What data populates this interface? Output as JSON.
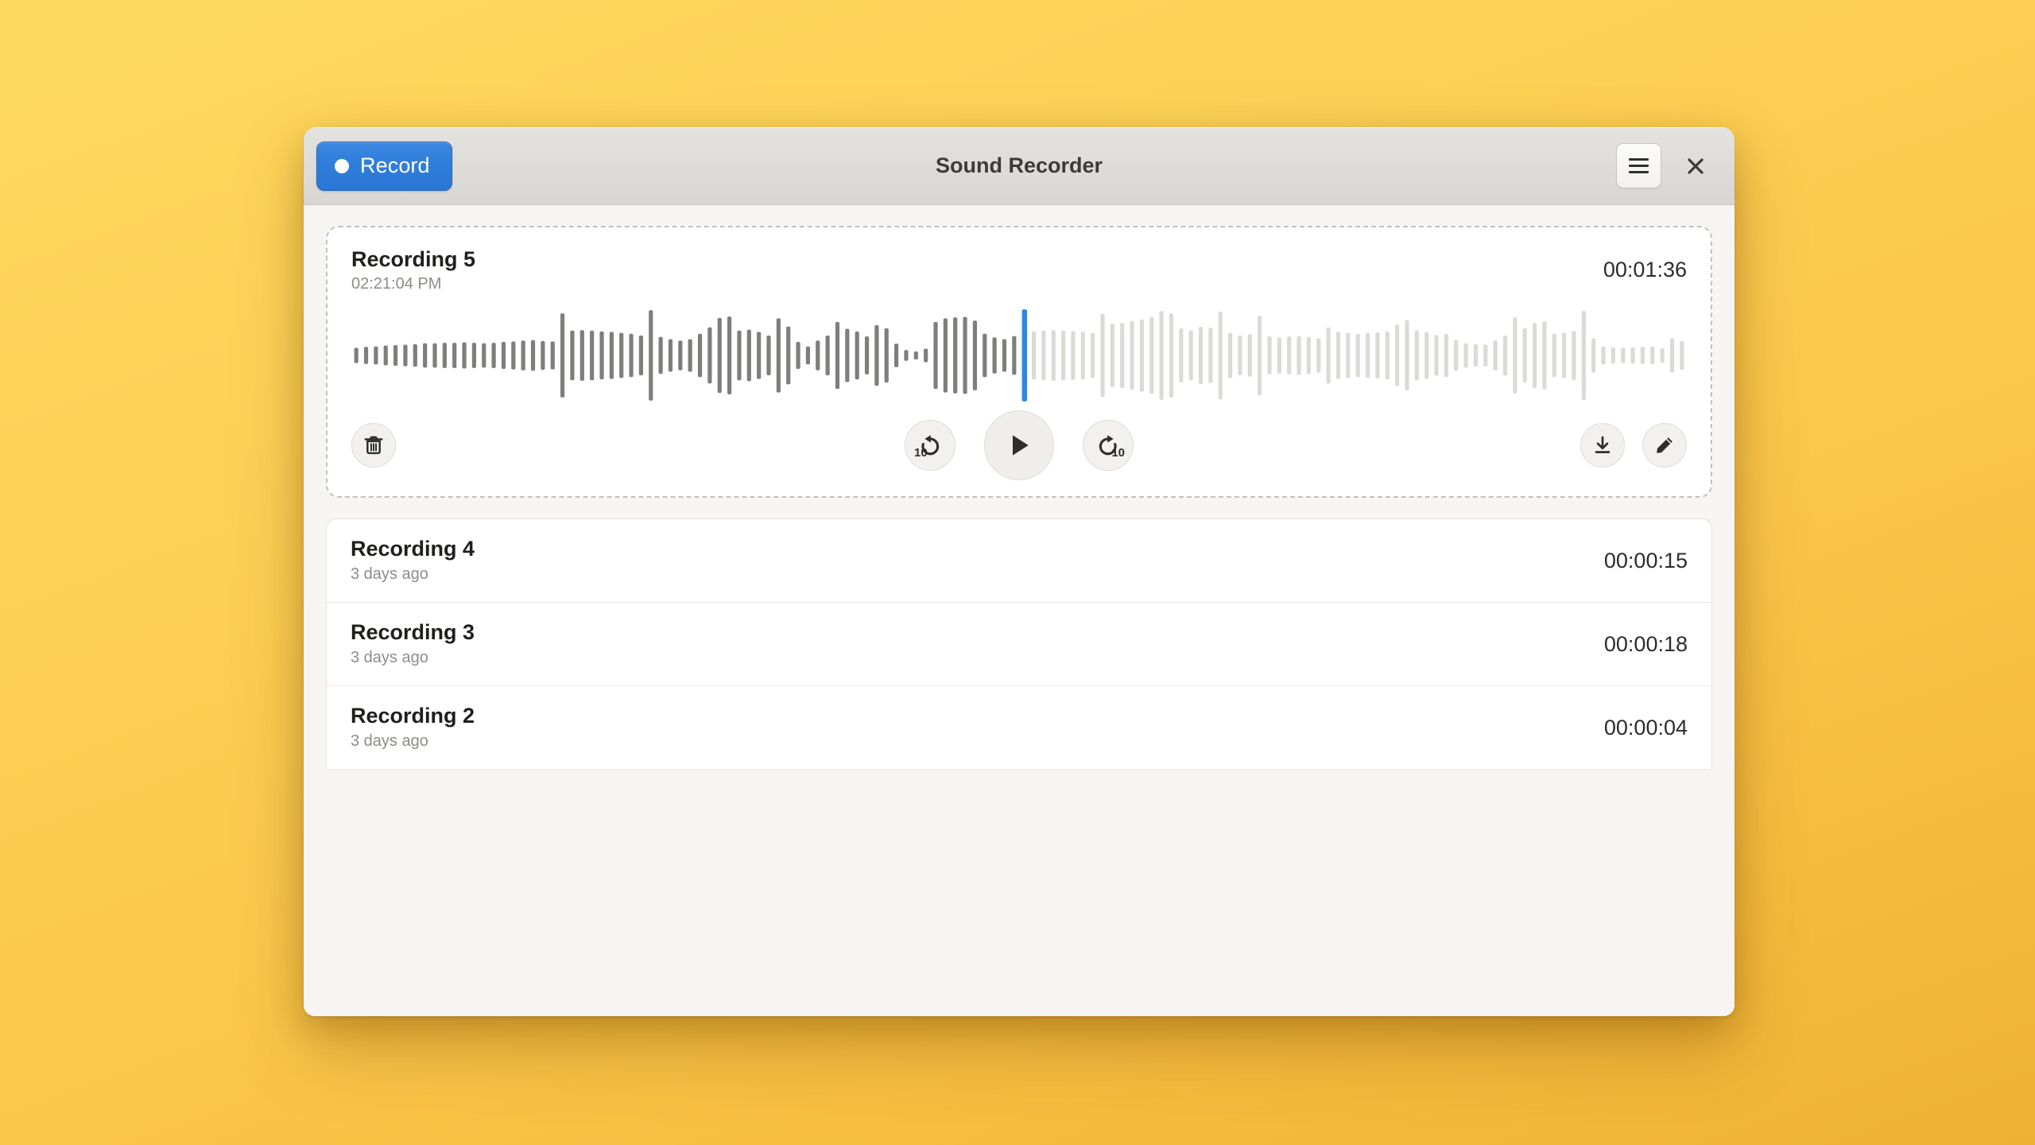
{
  "window": {
    "title": "Sound Recorder",
    "record_label": "Record",
    "menu_icon": "hamburger-menu-icon",
    "close_icon": "close-icon"
  },
  "player": {
    "name": "Recording 5",
    "timestamp": "02:21:04 PM",
    "duration": "00:01:36",
    "progress_percent": 50,
    "controls": {
      "delete_icon": "trash-icon",
      "seek_backward_label": "10",
      "seek_backward_icon": "seek-backward-10-icon",
      "play_icon": "play-icon",
      "seek_forward_label": "10",
      "seek_forward_icon": "seek-forward-10-icon",
      "export_icon": "download-icon",
      "rename_icon": "pencil-icon"
    },
    "waveform": {
      "played_color": "#7e7e7c",
      "unplayed_color": "#dcdad7",
      "playhead_color": "#3584e4",
      "amplitudes": [
        0.17,
        0.19,
        0.2,
        0.22,
        0.23,
        0.24,
        0.25,
        0.27,
        0.27,
        0.28,
        0.28,
        0.29,
        0.28,
        0.27,
        0.28,
        0.3,
        0.31,
        0.33,
        0.34,
        0.32,
        0.31,
        0.93,
        0.55,
        0.56,
        0.55,
        0.53,
        0.52,
        0.5,
        0.48,
        0.44,
        1.0,
        0.41,
        0.36,
        0.33,
        0.36,
        0.48,
        0.62,
        0.83,
        0.86,
        0.55,
        0.57,
        0.52,
        0.44,
        0.82,
        0.64,
        0.3,
        0.2,
        0.33,
        0.44,
        0.74,
        0.59,
        0.53,
        0.42,
        0.67,
        0.6,
        0.26,
        0.12,
        0.09,
        0.15,
        0.74,
        0.82,
        0.84,
        0.85,
        0.77,
        0.48,
        0.4,
        0.36,
        0.43,
        0.9,
        0.53,
        0.55,
        0.56,
        0.55,
        0.54,
        0.53,
        0.5,
        0.92,
        0.7,
        0.72,
        0.76,
        0.8,
        0.85,
        0.98,
        0.93,
        0.6,
        0.55,
        0.63,
        0.61,
        0.97,
        0.5,
        0.44,
        0.47,
        0.88,
        0.42,
        0.4,
        0.42,
        0.43,
        0.41,
        0.38,
        0.62,
        0.52,
        0.5,
        0.48,
        0.5,
        0.51,
        0.53,
        0.68,
        0.78,
        0.55,
        0.52,
        0.45,
        0.48,
        0.34,
        0.27,
        0.25,
        0.24,
        0.33,
        0.44,
        0.84,
        0.6,
        0.72,
        0.75,
        0.48,
        0.5,
        0.54,
        0.98,
        0.38,
        0.2,
        0.18,
        0.17,
        0.18,
        0.19,
        0.2,
        0.16,
        0.38,
        0.32
      ]
    }
  },
  "recordings": [
    {
      "name": "Recording 4",
      "subtitle": "3 days ago",
      "duration": "00:00:15"
    },
    {
      "name": "Recording 3",
      "subtitle": "3 days ago",
      "duration": "00:00:18"
    },
    {
      "name": "Recording 2",
      "subtitle": "3 days ago",
      "duration": "00:00:04"
    }
  ],
  "colors": {
    "accent": "#2f7ddb",
    "desktop_background_top": "#ffd95e",
    "desktop_background_bottom": "#efb134",
    "window_background": "#f6f5f4",
    "headerbar_background": "#dedcd8"
  }
}
